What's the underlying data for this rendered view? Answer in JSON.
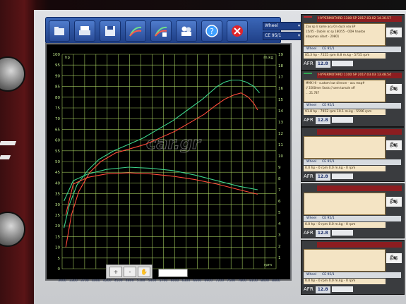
{
  "toolbar": {
    "buttons": [
      "open-file-icon",
      "print-icon",
      "save-icon",
      "dyno-run-icon",
      "dyno-compare-icon",
      "users-icon",
      "help-icon",
      "close-icon"
    ],
    "select_top": "Wheel",
    "select_bottom": "CE 95/1"
  },
  "plot": {
    "unit_left": "hp",
    "unit_right": "m.kg",
    "unit_x": "rpm",
    "watermark": "car.gr",
    "zoom_value": ""
  },
  "chart_data": {
    "type": "line",
    "title": "",
    "xlabel": "rpm",
    "ylabel_left": "hp",
    "ylabel_right": "m.kg",
    "xlim": [
      3000,
      8800
    ],
    "ylim_left": [
      0,
      100
    ],
    "ylim_right": [
      0,
      19
    ],
    "x_ticks": [
      "3000",
      "3300",
      "3700",
      "4000",
      "4200",
      "4500",
      "4800",
      "5100",
      "5400",
      "5700",
      "6000",
      "6300",
      "6600",
      "6900",
      "7200",
      "7500",
      "7800",
      "8100",
      "8400",
      "8800"
    ],
    "y_left_ticks": [
      "0",
      "5",
      "10",
      "15",
      "20",
      "25",
      "30",
      "35",
      "40",
      "45",
      "50",
      "55",
      "60",
      "65",
      "70",
      "75",
      "80",
      "85",
      "90",
      "95",
      "100"
    ],
    "y_right_ticks": [
      "1",
      "2",
      "3",
      "4",
      "5",
      "6",
      "7",
      "8",
      "9",
      "10",
      "11",
      "12",
      "13",
      "14",
      "15",
      "16",
      "17",
      "18",
      "19"
    ],
    "grid": true,
    "series": [
      {
        "color": "#3cd28a",
        "axis": "left",
        "x": [
          3050,
          3200,
          3400,
          3700,
          4000,
          4400,
          4800,
          5200,
          5600,
          6000,
          6400,
          6800,
          7000,
          7200,
          7400,
          7600,
          7800,
          8000,
          8200,
          8350
        ],
        "y": [
          19,
          30,
          39,
          46,
          51,
          55,
          58,
          61,
          65,
          69,
          74,
          79,
          82,
          85,
          87,
          88,
          88,
          87,
          85,
          82
        ]
      },
      {
        "color": "#ff4a3a",
        "axis": "left",
        "x": [
          3100,
          3250,
          3450,
          3750,
          4050,
          4450,
          4850,
          5250,
          5650,
          6050,
          6450,
          6850,
          7150,
          7400,
          7650,
          7850,
          8050,
          8200,
          8300
        ],
        "y": [
          10,
          25,
          36,
          45,
          50,
          54,
          56,
          58,
          61,
          64,
          68,
          72,
          76,
          79,
          81,
          82,
          80,
          77,
          74
        ]
      },
      {
        "color": "#3cd28a",
        "axis": "right",
        "x": [
          3050,
          3300,
          3700,
          4200,
          4800,
          5400,
          6000,
          6600,
          7200,
          7800,
          8300
        ],
        "y": [
          6.0,
          7.8,
          8.4,
          8.8,
          9.0,
          8.9,
          8.7,
          8.3,
          7.8,
          7.3,
          7.0
        ]
      },
      {
        "color": "#ff4a3a",
        "axis": "right",
        "x": [
          3100,
          3300,
          3700,
          4200,
          4800,
          5400,
          6000,
          6600,
          7200,
          7800,
          8300
        ],
        "y": [
          4.8,
          7.5,
          8.1,
          8.4,
          8.5,
          8.4,
          8.2,
          7.9,
          7.5,
          7.0,
          6.6
        ]
      }
    ]
  },
  "panels": [
    {
      "title": "HYPERMOTARD 1100 SP   2017.03.02 14.30.57",
      "stripe": "#c0282c",
      "lines": [
        "Ζεα sp // same acu  On duck sea EP",
        "15/45  -  Dublin sc sp 180/55  -  ODH haasbo",
        "abxpmox silant  -  20801"
      ],
      "wheel": "Wheel",
      "ce": "CE 95/1",
      "stats": "85.3 hp - 7555 rpm   8.8 m.kg - 5755 rpm",
      "afr": "AFR",
      "afr_value": "12.8"
    },
    {
      "title": "HYPERMOTARD 1100 SP   2017.03.03 13.48.54",
      "stripe": "#2fa84f",
      "lines": [
        "MMX HI  -  custom low silencer  -  acu map#",
        "// 3500mm Seals // oem tamale off",
        "... 21.787"
      ],
      "wheel": "Wheel",
      "ce": "CE 95/1",
      "stats": "91.8 hp - 7952 rpm   10.1 m.kg - 5596 rpm",
      "afr": "AFR",
      "afr_value": "12.8"
    },
    {
      "title": "",
      "stripe": "#3a3c3f",
      "lines": [],
      "wheel": "Wheel",
      "ce": "CE 95/1",
      "stats": "0.0 hp - 0 rpm   0.0 m.kg - 0 rpm",
      "afr": "AFR",
      "afr_value": "12.8"
    },
    {
      "title": "",
      "stripe": "#3a3c3f",
      "lines": [],
      "wheel": "Wheel",
      "ce": "CE 95/1",
      "stats": "0.0 hp - 0 rpm   0.0 m.kg - 0 rpm",
      "afr": "AFR",
      "afr_value": "12.8"
    },
    {
      "title": "",
      "stripe": "#3a3c3f",
      "lines": [],
      "wheel": "Wheel",
      "ce": "CE 95/1",
      "stats": "0.0 hp - 0 rpm   0.0 m.kg - 0 rpm",
      "afr": "AFR",
      "afr_value": "12.8"
    }
  ]
}
